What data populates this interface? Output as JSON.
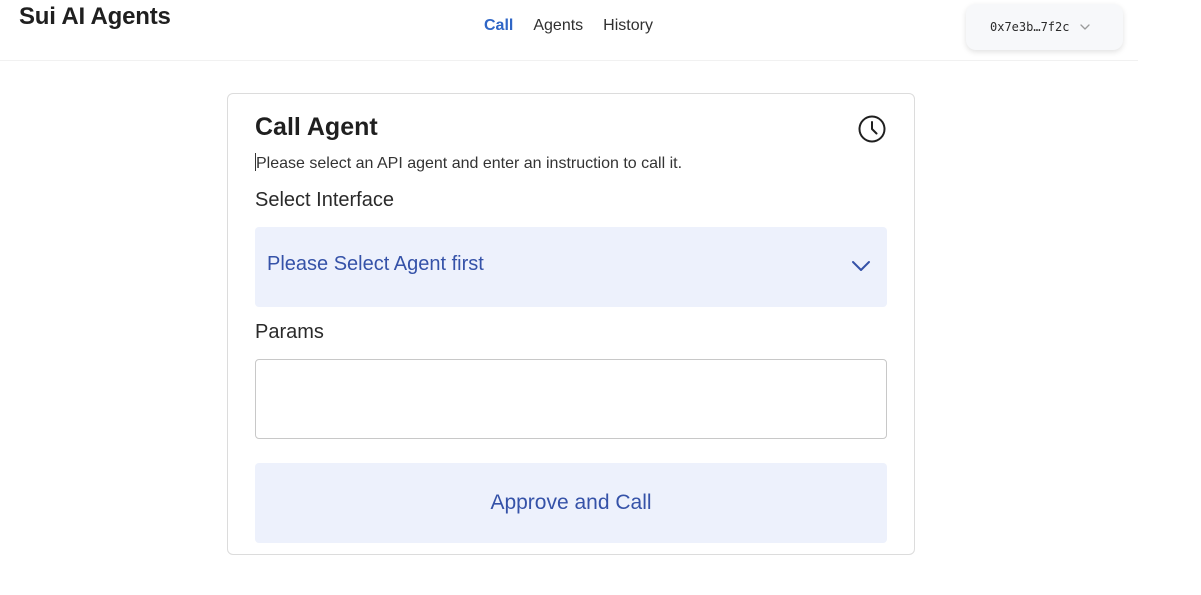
{
  "app": {
    "title": "Sui AI Agents"
  },
  "nav": {
    "items": [
      {
        "label": "Call",
        "active": true
      },
      {
        "label": "Agents",
        "active": false
      },
      {
        "label": "History",
        "active": false
      }
    ]
  },
  "wallet": {
    "address": "0x7e3b…7f2c",
    "icon": "chevron-down-icon"
  },
  "card": {
    "title": "Call Agent",
    "history_icon": "clock-icon",
    "description": "Please select an API agent and enter an instruction to call it.",
    "interface": {
      "label": "Select Interface",
      "selected_value": "Please Select Agent first",
      "icon": "chevron-down-icon"
    },
    "params": {
      "label": "Params",
      "value": "",
      "placeholder": ""
    },
    "submit_label": "Approve and Call"
  },
  "colors": {
    "accent": "#2f66c6",
    "button_bg": "#edf1fc",
    "button_text": "#3552a8"
  }
}
